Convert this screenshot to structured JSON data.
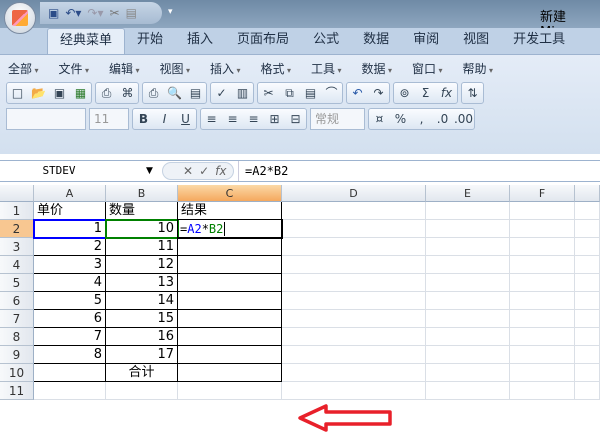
{
  "window": {
    "title": "新建 Micro"
  },
  "qat": {
    "icons": [
      "save-icon",
      "undo-icon",
      "redo-icon",
      "tools-icon",
      "paste-icon"
    ]
  },
  "tabs": [
    "经典菜单",
    "开始",
    "插入",
    "页面布局",
    "公式",
    "数据",
    "审阅",
    "视图",
    "开发工具"
  ],
  "menus": [
    "全部",
    "文件",
    "编辑",
    "视图",
    "插入",
    "格式",
    "工具",
    "数据",
    "窗口",
    "帮助"
  ],
  "format": {
    "font_size": "11",
    "number_format": "常规",
    "bold": "B",
    "italic": "I",
    "underline": "U",
    "percent": "%",
    "comma": ","
  },
  "formula_bar": {
    "name_box": "STDEV",
    "formula": "=A2*B2",
    "fx": "fx"
  },
  "columns": [
    "A",
    "B",
    "C",
    "D",
    "E",
    "F"
  ],
  "rows": [
    "1",
    "2",
    "3",
    "4",
    "5",
    "6",
    "7",
    "8",
    "9",
    "10",
    "11"
  ],
  "cells": {
    "a1": "单价",
    "b1": "数量",
    "c1": "结果",
    "a": [
      "1",
      "2",
      "3",
      "4",
      "5",
      "6",
      "7",
      "8"
    ],
    "b": [
      "10",
      "11",
      "12",
      "13",
      "14",
      "15",
      "16",
      "17"
    ],
    "b10": "合计",
    "c2_eq": "=",
    "c2_ref1": "A2",
    "c2_op": "*",
    "c2_ref2": "B2"
  },
  "colors": {
    "ref1": "#0000ff",
    "ref2": "#008000",
    "arrow": "#e8202a"
  }
}
